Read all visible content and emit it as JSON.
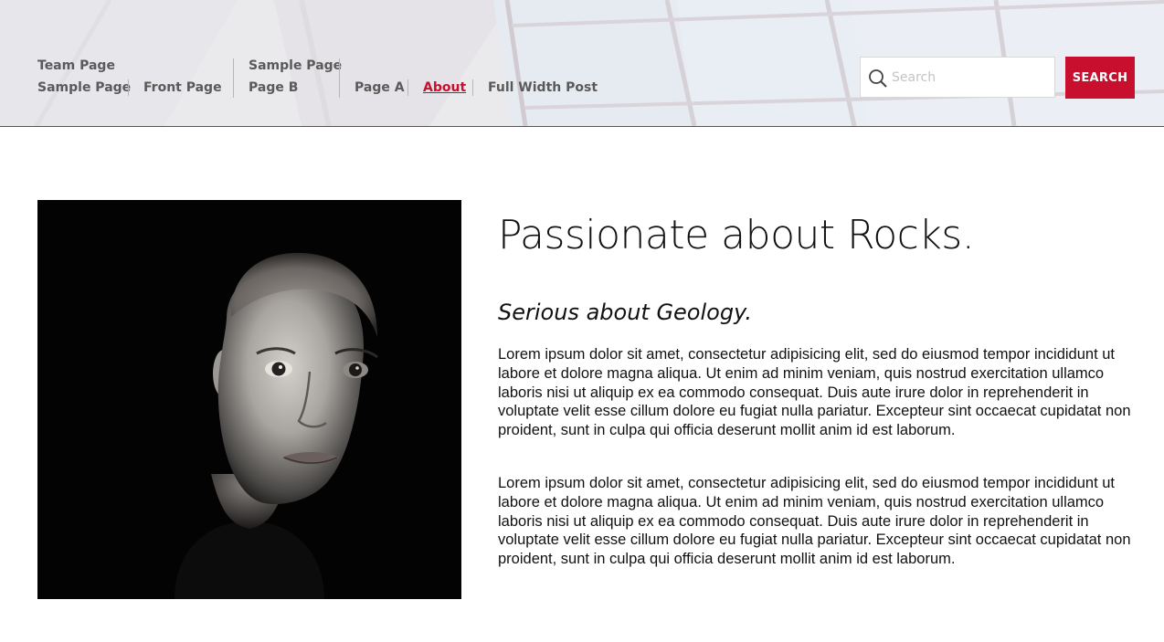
{
  "nav": {
    "items": [
      {
        "label": "Team Page",
        "active": false
      },
      {
        "label": "Sample Page",
        "active": false
      },
      {
        "label": "Front Page",
        "active": false
      },
      {
        "label": "Sample Page",
        "active": false
      },
      {
        "label": "Page B",
        "active": false
      },
      {
        "label": "Page A",
        "active": false
      },
      {
        "label": "About",
        "active": true
      },
      {
        "label": "Full Width Post",
        "active": false
      }
    ]
  },
  "search": {
    "placeholder": "Search",
    "value": "",
    "button_label": "SEARCH"
  },
  "icons": {
    "search": "search-icon"
  },
  "colors": {
    "accent": "#c8102e",
    "nav_text": "#5a5a5a",
    "body_text": "#111111"
  },
  "main": {
    "title": "Passionate about Rocks.",
    "subtitle": "Serious about Geology.",
    "paragraphs": [
      "Lorem ipsum dolor sit amet, consectetur adipisicing elit, sed do eiusmod tempor incididunt ut labore et dolore magna aliqua. Ut enim ad minim veniam, quis nostrud exercitation ullamco laboris nisi ut aliquip ex ea commodo consequat. Duis aute irure dolor in reprehenderit in voluptate velit esse cillum dolore eu fugiat nulla pariatur. Excepteur sint occaecat cupidatat non proident, sunt in culpa qui officia deserunt mollit anim id est laborum.",
      "Lorem ipsum dolor sit amet, consectetur adipisicing elit, sed do eiusmod tempor incididunt ut labore et dolore magna aliqua. Ut enim ad minim veniam, quis nostrud exercitation ullamco laboris nisi ut aliquip ex ea commodo consequat. Duis aute irure dolor in reprehenderit in voluptate velit esse cillum dolore eu fugiat nulla pariatur. Excepteur sint occaecat cupidatat non proident, sunt in culpa qui officia deserunt mollit anim id est laborum."
    ]
  }
}
